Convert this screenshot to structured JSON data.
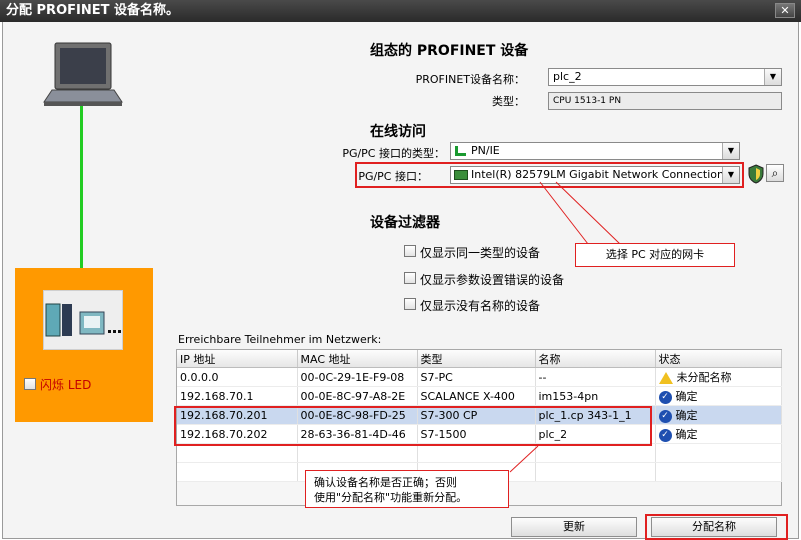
{
  "window": {
    "title": "分配 PROFINET 设备名称。",
    "close_label": "✕"
  },
  "left_panel": {
    "flash_led_label": "闪烁 LED"
  },
  "configured": {
    "heading": "组态的 PROFINET 设备",
    "device_name_label": "PROFINET设备名称：",
    "device_name_value": "plc_2",
    "type_label": "类型：",
    "type_value": "CPU 1513-1 PN"
  },
  "online": {
    "heading": "在线访问",
    "interface_type_label": "PG/PC 接口的类型：",
    "interface_type_value": "PN/IE",
    "interface_label": "PG/PC 接口：",
    "interface_value": "Intel(R) 82579LM Gigabit Network Connection"
  },
  "filter": {
    "heading": "设备过滤器",
    "options": [
      "仅显示同一类型的设备",
      "仅显示参数设置错误的设备",
      "仅显示没有名称的设备"
    ]
  },
  "callouts": {
    "nic": "选择 PC 对应的网卡",
    "confirm_line1": "确认设备名称是否正确；否则",
    "confirm_line2": "使用\"分配名称\"功能重新分配。"
  },
  "table": {
    "caption": "Erreichbare Teilnehmer im Netzwerk:",
    "headers": [
      "IP 地址",
      "MAC 地址",
      "类型",
      "名称",
      "状态"
    ],
    "rows": [
      {
        "ip": "0.0.0.0",
        "mac": "00-0C-29-1E-F9-08",
        "type": "S7-PC",
        "name": "--",
        "status": "未分配名称",
        "status_icon": "warning-icon"
      },
      {
        "ip": "192.168.70.1",
        "mac": "00-0E-8C-97-A8-2E",
        "type": "SCALANCE X-400",
        "name": "im153-4pn",
        "status": "确定",
        "status_icon": "check-icon"
      },
      {
        "ip": "192.168.70.201",
        "mac": "00-0E-8C-98-FD-25",
        "type": "S7-300 CP",
        "name": "plc_1.cp 343-1_1",
        "status": "确定",
        "status_icon": "check-icon"
      },
      {
        "ip": "192.168.70.202",
        "mac": "28-63-36-81-4D-46",
        "type": "S7-1500",
        "name": "plc_2",
        "status": "确定",
        "status_icon": "check-icon"
      }
    ]
  },
  "buttons": {
    "refresh": "更新",
    "assign_name": "分配名称"
  },
  "colors": {
    "accent_orange": "#ff9900",
    "highlight_red": "#e02020",
    "selection": "#c9d8ef",
    "cable_green": "#22cc22"
  }
}
